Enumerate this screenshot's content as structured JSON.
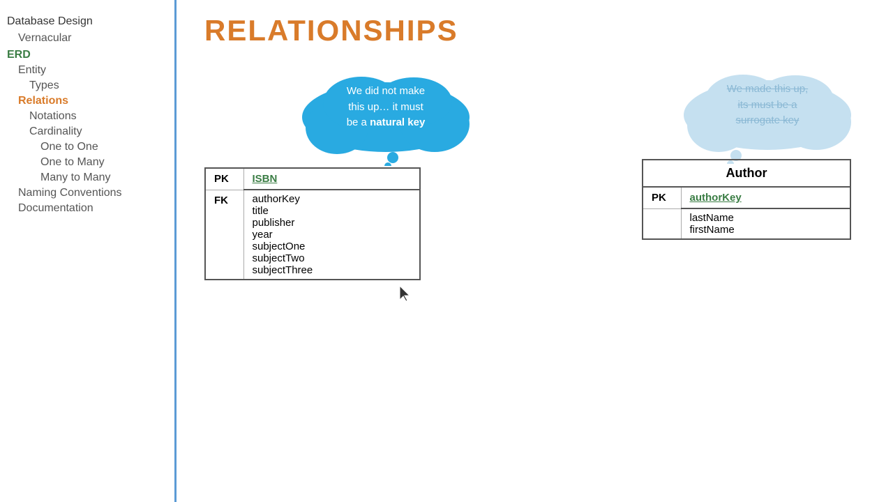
{
  "sidebar": {
    "items": [
      {
        "label": "Database Design",
        "level": 0,
        "style": "normal"
      },
      {
        "label": "Vernacular",
        "level": 1,
        "style": "normal"
      },
      {
        "label": "ERD",
        "level": 0,
        "style": "green"
      },
      {
        "label": "Entity",
        "level": 1,
        "style": "normal"
      },
      {
        "label": "Types",
        "level": 2,
        "style": "normal"
      },
      {
        "label": "Relations",
        "level": 1,
        "style": "active"
      },
      {
        "label": "Notations",
        "level": 2,
        "style": "normal"
      },
      {
        "label": "Cardinality",
        "level": 2,
        "style": "normal"
      },
      {
        "label": "One to One",
        "level": 3,
        "style": "normal"
      },
      {
        "label": "One to Many",
        "level": 3,
        "style": "normal"
      },
      {
        "label": "Many to Many",
        "level": 3,
        "style": "normal"
      },
      {
        "label": "Naming Conventions",
        "level": 1,
        "style": "normal"
      },
      {
        "label": "Documentation",
        "level": 1,
        "style": "normal"
      }
    ]
  },
  "main": {
    "title": "RELATIONSHIPS",
    "thought_left": {
      "line1": "We did not make",
      "line2": "this up… it must",
      "line3": "be a ",
      "bold": "natural key"
    },
    "thought_right": {
      "line1": "We made this up,",
      "line2": "its must be a",
      "line3": "surrogate key"
    },
    "left_table": {
      "pk_label": "PK",
      "pk_value": "ISBN",
      "fk_label": "FK",
      "fields": [
        "authorKey",
        "title",
        "publisher",
        "year",
        "subjectOne",
        "subjectTwo",
        "subjectThree"
      ]
    },
    "right_table": {
      "title": "Author",
      "pk_label": "PK",
      "pk_value": "authorKey",
      "fields": [
        "lastName",
        "firstName"
      ]
    }
  }
}
